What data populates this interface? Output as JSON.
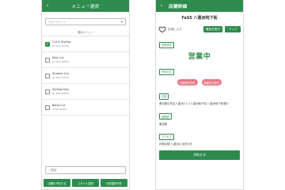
{
  "left": {
    "header": {
      "back": "‹",
      "title": "メニュー選択"
    },
    "store_select": {
      "value": "やむアカウント"
    },
    "section_label": "基本メニュー",
    "items": [
      {
        "name": "Cut & Styling",
        "price": "¥1,200 (¥350)",
        "checked": true
      },
      {
        "name": "Kids Cut",
        "price": "¥1,000 (¥350)",
        "checked": false
      },
      {
        "name": "Student Cut",
        "price": "¥1,000 (¥350)",
        "checked": false
      },
      {
        "name": "Styling Only",
        "price": "¥1,000 (¥350)",
        "checked": false
      },
      {
        "name": "Bang Cut",
        "price": "¥700 (¥350)",
        "checked": false
      }
    ],
    "note_placeholder": "ご要望",
    "buttons": {
      "by_store": "店舗を予約する",
      "by_staff": "スタイル選択",
      "by_date": "日時選択予約"
    }
  },
  "right": {
    "header": {
      "back": "‹",
      "title": "店舗詳細"
    },
    "store_name": "FaSS 八重洲地下街",
    "favorite_label": "お気に入り",
    "phone_button": "電話を受付",
    "map_button": "マップ",
    "sections": {
      "status_label": "営業状況",
      "status_value": "営業中",
      "reservation_label": "予約方法",
      "reservation_pills": [
        "日時優先予約",
        "順番待ち受付"
      ],
      "address_label": "住所",
      "address_value": "東京都中央区八重洲2-1-1八重洲地下街 八重洲地下街通り",
      "hours_label": "最寄駅",
      "hours_value": "東京駅",
      "access_label": "アクセス",
      "access_value": "JR東京駅 八重洲口 徒歩1分"
    },
    "reserve_button": "予約する"
  },
  "colors": {
    "accent": "#2e8b4e",
    "pink": "#e87a86"
  }
}
